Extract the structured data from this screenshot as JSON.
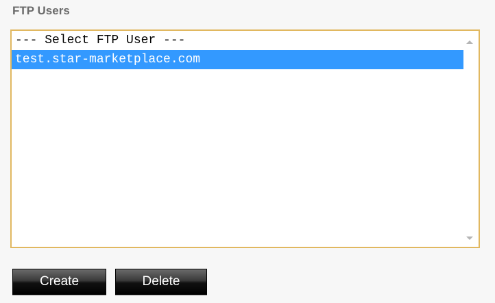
{
  "section": {
    "title": "FTP Users"
  },
  "ftp_user_list": {
    "options": [
      {
        "label": "--- Select FTP User ---",
        "selected": false
      },
      {
        "label": "test.star-marketplace.com",
        "selected": true
      }
    ]
  },
  "actions": {
    "create_label": "Create",
    "delete_label": "Delete"
  },
  "colors": {
    "border_accent": "#e1b860",
    "selection": "#3399ff",
    "title_text": "#6b6b6b",
    "button_dark": "#000000"
  },
  "icons": {
    "scroll_up": "scroll-up-arrow-icon",
    "scroll_down": "scroll-down-arrow-icon"
  }
}
